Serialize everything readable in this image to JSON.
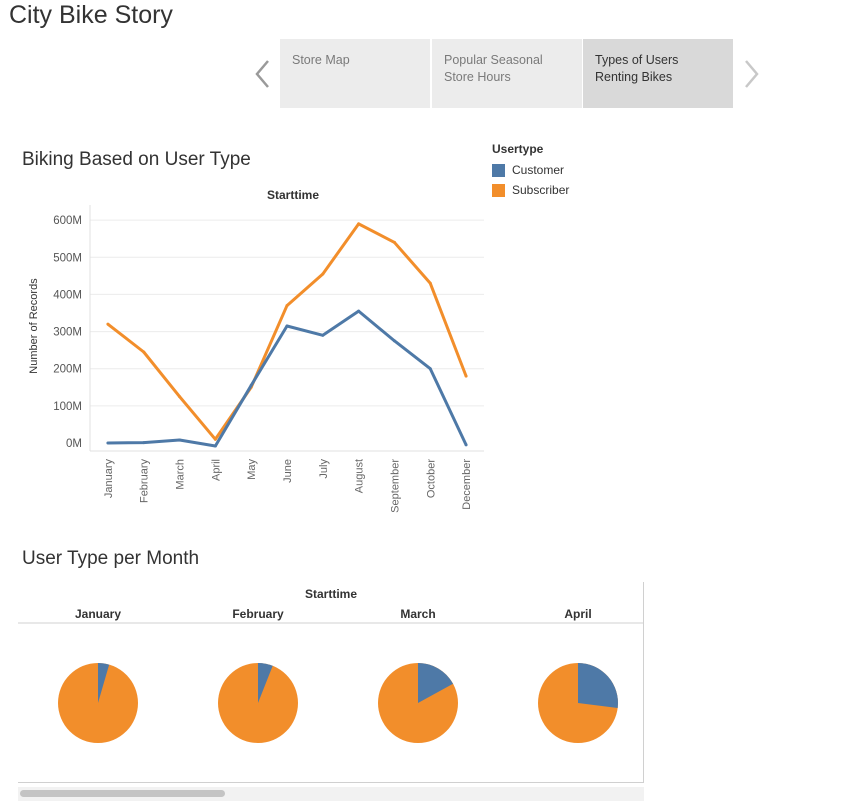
{
  "story": {
    "title": "City Bike Story",
    "points": [
      {
        "label": "Store Map"
      },
      {
        "label": "Popular Seasonal Store Hours"
      },
      {
        "label": "Types of Users Renting Bikes"
      }
    ]
  },
  "line_section": {
    "title": "Biking Based on User Type"
  },
  "pie_section": {
    "title": "User Type per Month"
  },
  "legend": {
    "title": "Usertype",
    "items": [
      {
        "label": "Customer",
        "color": "#4e79a7"
      },
      {
        "label": "Subscriber",
        "color": "#f28e2b"
      }
    ]
  },
  "colors": {
    "customer": "#4e79a7",
    "subscriber": "#f28e2b",
    "active_tab": "#d9d9d9",
    "tab": "#ececec"
  },
  "chart_data": [
    {
      "type": "line",
      "title": "",
      "header": "Starttime",
      "xlabel": "",
      "ylabel": "Number of Records",
      "categories": [
        "January",
        "February",
        "March",
        "April",
        "May",
        "June",
        "July",
        "August",
        "September",
        "October",
        "December"
      ],
      "ylim": [
        0,
        630
      ],
      "y_ticks": [
        {
          "value": 0,
          "label": "0M"
        },
        {
          "value": 100,
          "label": "100M"
        },
        {
          "value": 200,
          "label": "200M"
        },
        {
          "value": 300,
          "label": "300M"
        },
        {
          "value": 400,
          "label": "400M"
        },
        {
          "value": 500,
          "label": "500M"
        },
        {
          "value": 600,
          "label": "600M"
        }
      ],
      "series": [
        {
          "name": "Customer",
          "values": [
            0,
            1,
            8,
            -8,
            155,
            315,
            290,
            355,
            275,
            200,
            -5
          ]
        },
        {
          "name": "Subscriber",
          "values": [
            320,
            245,
            125,
            10,
            150,
            370,
            455,
            590,
            540,
            430,
            180
          ]
        }
      ],
      "grid": true
    },
    {
      "type": "pie",
      "header": "Starttime",
      "panels": [
        {
          "label": "January",
          "customer_share": 0.045,
          "subscriber_share": 0.955
        },
        {
          "label": "February",
          "customer_share": 0.06,
          "subscriber_share": 0.94
        },
        {
          "label": "March",
          "customer_share": 0.17,
          "subscriber_share": 0.83
        },
        {
          "label": "April",
          "customer_share": 0.27,
          "subscriber_share": 0.73
        }
      ]
    }
  ]
}
